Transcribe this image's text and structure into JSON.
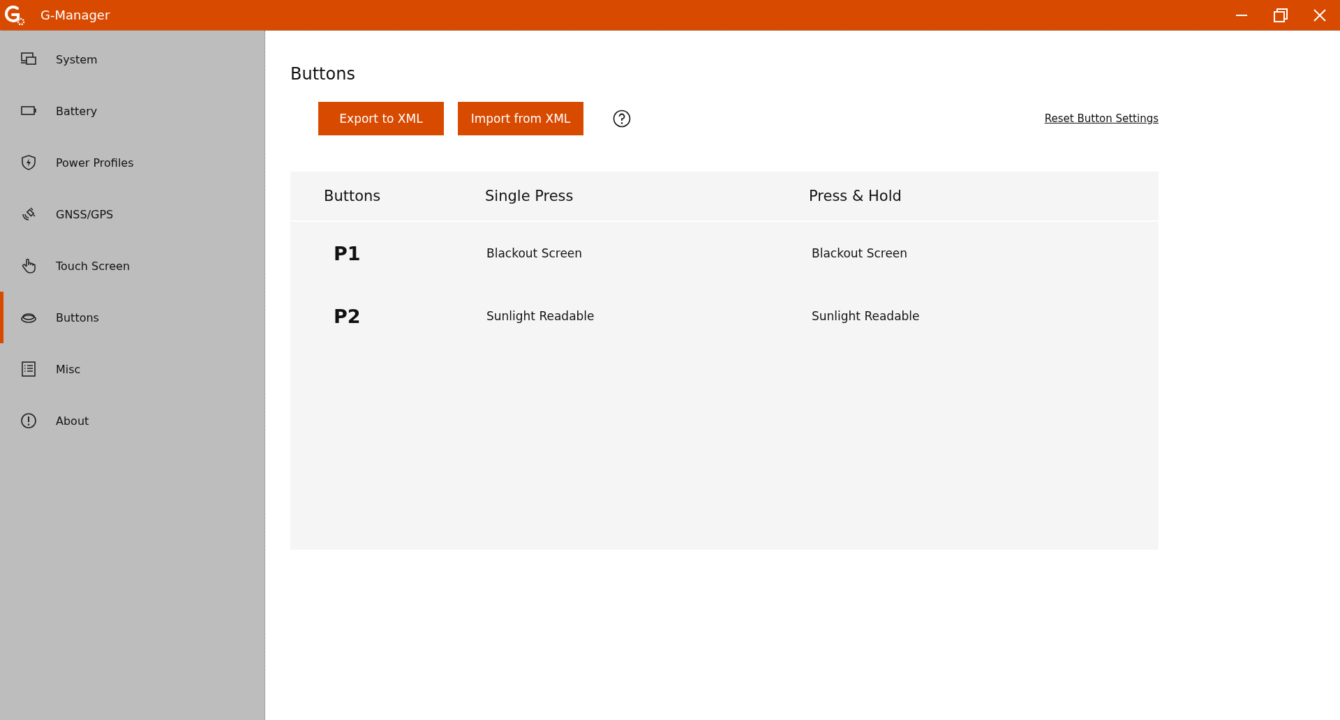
{
  "window": {
    "title": "G-Manager"
  },
  "sidebar": {
    "items": [
      {
        "label": "System",
        "selected": false
      },
      {
        "label": "Battery",
        "selected": false
      },
      {
        "label": "Power Profiles",
        "selected": false
      },
      {
        "label": "GNSS/GPS",
        "selected": false
      },
      {
        "label": "Touch Screen",
        "selected": false
      },
      {
        "label": "Buttons",
        "selected": true
      },
      {
        "label": "Misc",
        "selected": false
      },
      {
        "label": "About",
        "selected": false
      }
    ]
  },
  "page": {
    "title": "Buttons",
    "actions": [
      "Export to XML",
      "Import from XML"
    ],
    "reset_link": "Reset Button Settings"
  },
  "table": {
    "columns": [
      "Buttons",
      "Single Press",
      "Press & Hold"
    ],
    "rows": [
      {
        "button": "P1",
        "single_press": "Blackout Screen",
        "press_hold": "Blackout Screen"
      },
      {
        "button": "P2",
        "single_press": "Sunlight Readable",
        "press_hold": "Sunlight Readable"
      }
    ]
  }
}
